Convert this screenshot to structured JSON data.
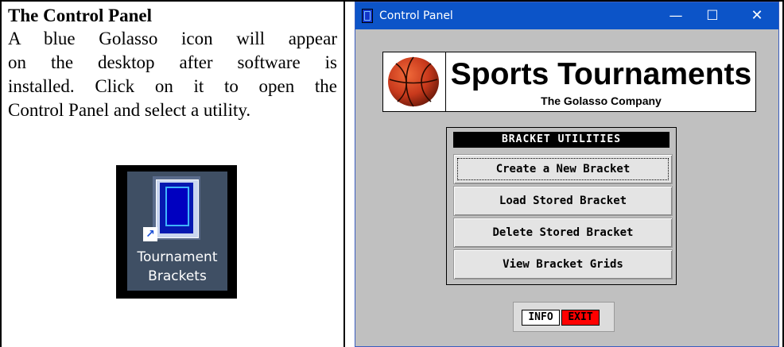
{
  "document": {
    "heading": "The Control Panel",
    "paragraph_lines": [
      "A blue Golasso icon will appear",
      "on the desktop after software is",
      "installed.  Click on it to open the",
      "Control Panel and select a utility."
    ]
  },
  "desktop_icon": {
    "label_line1": "Tournament",
    "label_line2": "Brackets",
    "icon": "tournament-brackets-app-icon",
    "overlay_icon": "shortcut-arrow-icon"
  },
  "window": {
    "title": "Control Panel",
    "controls": {
      "minimize": "—",
      "maximize": "☐",
      "close": "✕"
    },
    "banner": {
      "logo_icon": "basketball-icon",
      "title": "Sports Tournaments",
      "subtitle": "The Golasso Company"
    },
    "utilities": {
      "header": "BRACKET UTILITIES",
      "buttons": [
        "Create a New Bracket",
        "Load Stored Bracket",
        "Delete Stored Bracket",
        "View Bracket Grids"
      ]
    },
    "info_label": "INFO",
    "exit_label": "EXIT"
  },
  "colors": {
    "titlebar": "#0c54c8",
    "window_bg": "#c0c0c0",
    "exit": "#ff0000",
    "icon_blue": "#0618b0"
  }
}
